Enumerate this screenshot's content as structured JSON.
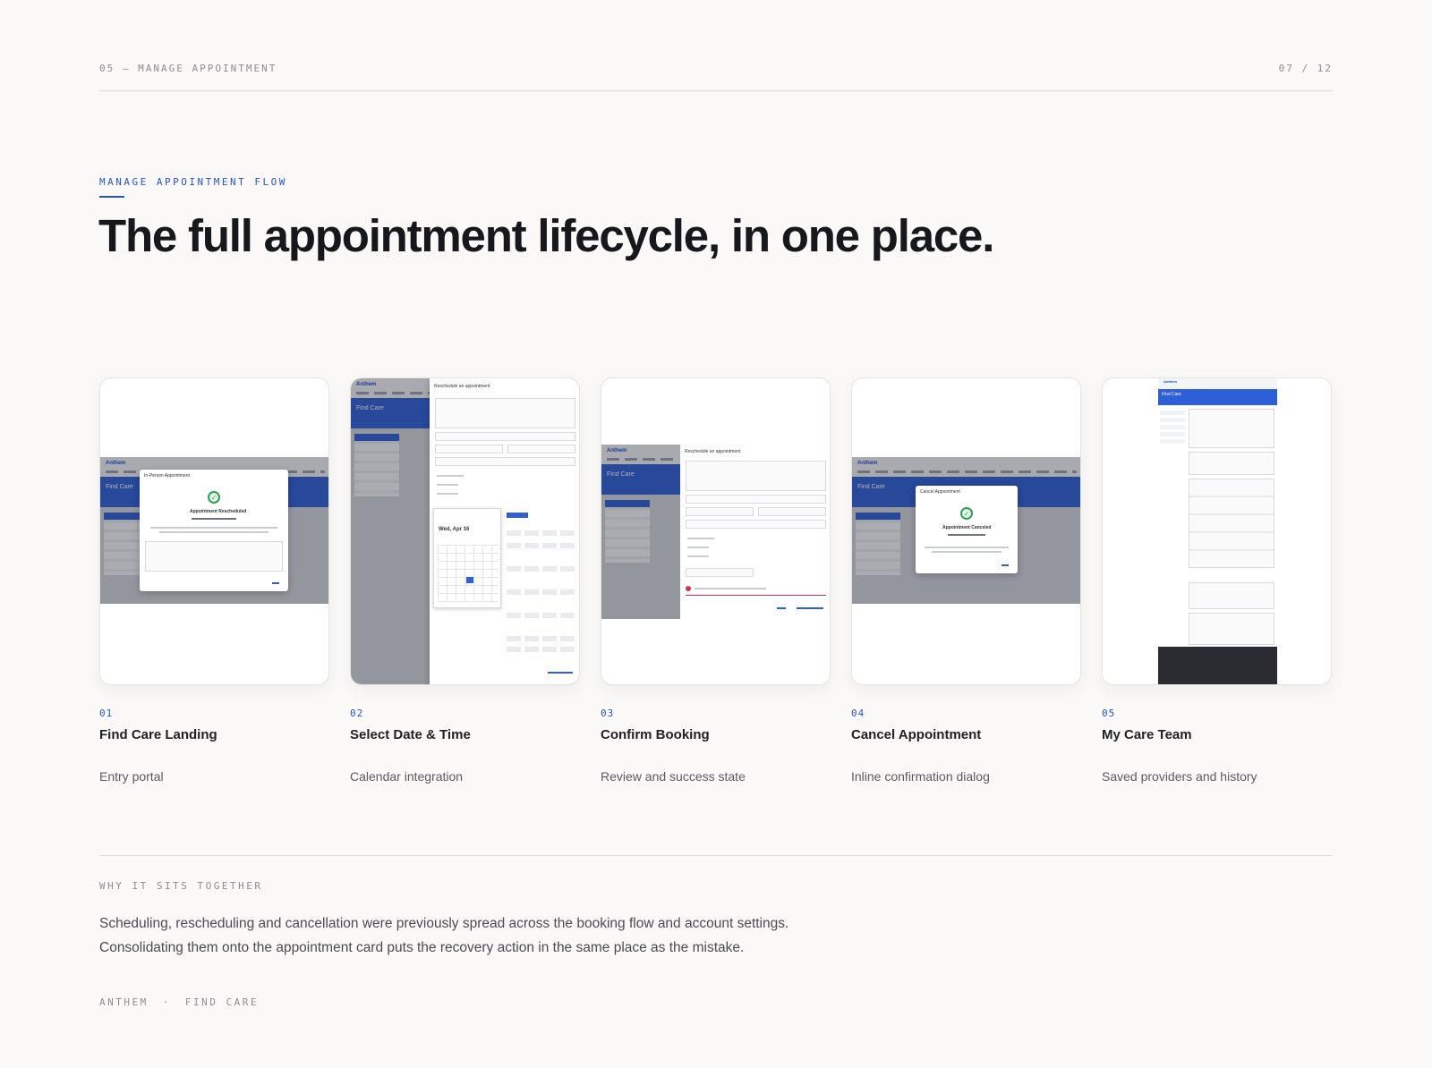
{
  "header": {
    "section": "05 — MANAGE APPOINTMENT",
    "page_counter": "07 / 12"
  },
  "intro": {
    "eyebrow": "MANAGE APPOINTMENT FLOW",
    "headline": "The full appointment lifecycle, in one place."
  },
  "cards": [
    {
      "number": "01",
      "title": "Find Care Landing",
      "description": "Entry portal",
      "screen": {
        "logo": "Anthem",
        "band": "Find Care",
        "modal_title": "In-Person Appointment",
        "modal_heading": "Appointment Rescheduled"
      }
    },
    {
      "number": "02",
      "title": "Select Date & Time",
      "description": "Calendar integration",
      "screen": {
        "logo": "Anthem",
        "band": "Find Care",
        "modal_title": "Reschedule an appointment",
        "date_label": "Wed, Apr 16"
      }
    },
    {
      "number": "03",
      "title": "Confirm Booking",
      "description": "Review and success state",
      "screen": {
        "logo": "Anthem",
        "band": "Find Care",
        "modal_title": "Reschedule an appointment"
      }
    },
    {
      "number": "04",
      "title": "Cancel Appointment",
      "description": "Inline confirmation dialog",
      "screen": {
        "logo": "Anthem",
        "band": "Find Care",
        "modal_title": "Cancel Appointment",
        "modal_heading": "Appointment Canceled"
      }
    },
    {
      "number": "05",
      "title": "My Care Team",
      "description": "Saved providers and history",
      "screen": {
        "logo": "Anthem",
        "band": "Find Care"
      }
    }
  ],
  "why": {
    "label": "WHY IT SITS TOGETHER",
    "line1": "Scheduling, rescheduling and cancellation were previously spread across the booking flow and account settings.",
    "line2": "Consolidating them onto the appointment card puts the recovery action in the same place as the mistake."
  },
  "footer": {
    "brand": "ANTHEM",
    "separator": "·",
    "product": "FIND CARE"
  },
  "colors": {
    "accent": "#2653d9",
    "brand_band": "#2e5ed8",
    "success": "#2e9e58",
    "background": "#faf9f7"
  }
}
